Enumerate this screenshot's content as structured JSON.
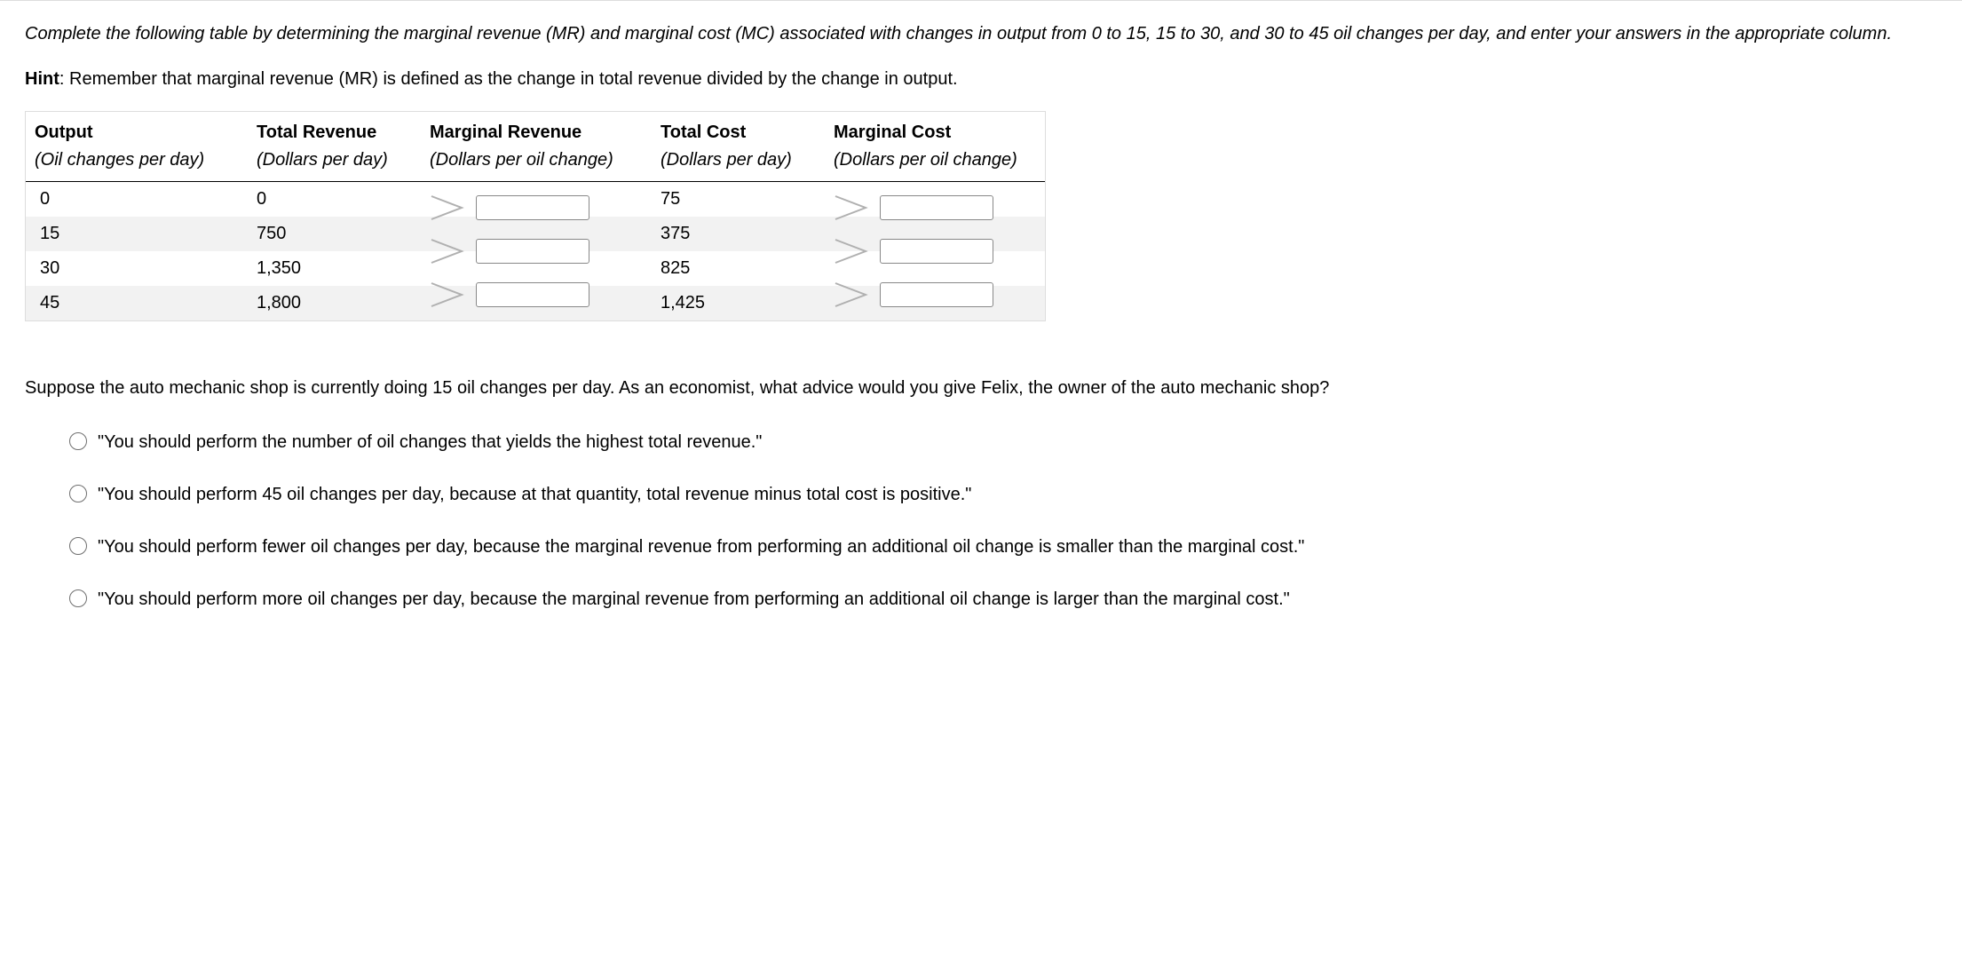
{
  "instructions": "Complete the following table by determining the marginal revenue (MR) and marginal cost (MC) associated with changes in output from 0 to 15, 15 to 30, and 30 to 45 oil changes per day, and enter your answers in the appropriate column.",
  "hint_label": "Hint",
  "hint_text": ": Remember that marginal revenue (MR) is defined as the change in total revenue divided by the change in output.",
  "table": {
    "headers": {
      "output": {
        "title": "Output",
        "unit": "(Oil changes per day)"
      },
      "tr": {
        "title": "Total Revenue",
        "unit": "(Dollars per day)"
      },
      "mr": {
        "title": "Marginal Revenue",
        "unit": "(Dollars per oil change)"
      },
      "tc": {
        "title": "Total Cost",
        "unit": "(Dollars per day)"
      },
      "mc": {
        "title": "Marginal Cost",
        "unit": "(Dollars per oil change)"
      }
    },
    "rows": [
      {
        "output": "0",
        "tr": "0",
        "tc": "75"
      },
      {
        "output": "15",
        "tr": "750",
        "tc": "375"
      },
      {
        "output": "30",
        "tr": "1,350",
        "tc": "825"
      },
      {
        "output": "45",
        "tr": "1,800",
        "tc": "1,425"
      }
    ],
    "marginal_mr": [
      "",
      "",
      ""
    ],
    "marginal_mc": [
      "",
      "",
      ""
    ]
  },
  "question": "Suppose the auto mechanic shop is currently doing 15 oil changes per day. As an economist, what advice would you give Felix, the owner of the auto mechanic shop?",
  "options": [
    "\"You should perform the number of oil changes that yields the highest total revenue.\"",
    "\"You should perform 45 oil changes per day, because at that quantity, total revenue minus total cost is positive.\"",
    "\"You should perform fewer oil changes per day, because the marginal revenue from performing an additional oil change is smaller than the marginal cost.\"",
    "\"You should perform more oil changes per day, because the marginal revenue from performing an additional oil change is larger than the marginal cost.\""
  ]
}
